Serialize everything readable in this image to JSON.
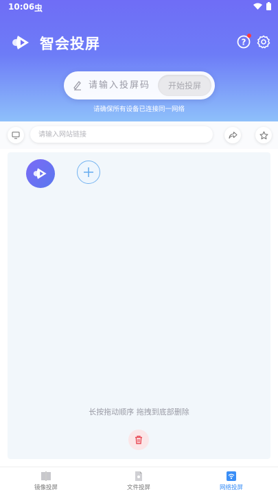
{
  "status_bar": {
    "time": "10:06",
    "app_indicator": "虫"
  },
  "header": {
    "title": "智会投屏",
    "code_placeholder": "请输入投屏码",
    "start_button": "开始投屏",
    "network_hint": "请确保所有设备已连接同一网络"
  },
  "url_bar": {
    "placeholder": "请输入网站链接"
  },
  "content": {
    "drag_hint": "长按拖动顺序 拖拽到底部删除"
  },
  "bottom_nav": {
    "items": [
      {
        "label": "镜像投屏",
        "icon": "mirror-icon",
        "active": false
      },
      {
        "label": "文件投屏",
        "icon": "file-icon",
        "active": false
      },
      {
        "label": "网络投屏",
        "icon": "network-icon",
        "active": true
      }
    ]
  },
  "colors": {
    "header_start": "#6f6df6",
    "header_end": "#8ec0fa",
    "accent": "#3a8ef6",
    "delete": "#e84a55"
  }
}
